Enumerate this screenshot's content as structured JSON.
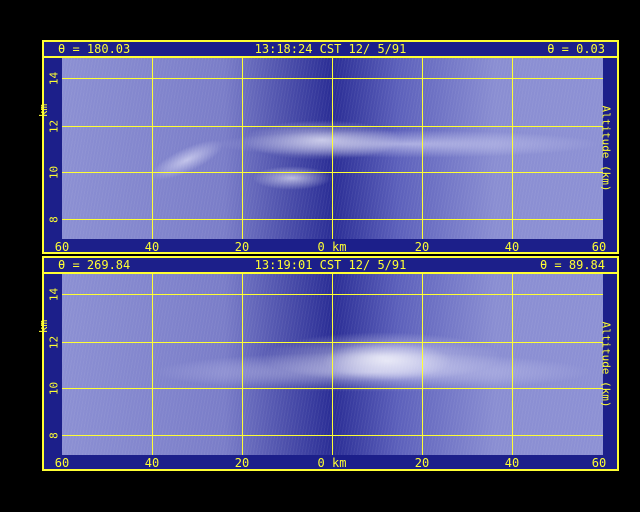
{
  "top_panel": {
    "theta_left": "θ = 180.03",
    "timestamp": "13:18:24 CST 12/ 5/91",
    "theta_right": "θ = 0.03",
    "y_label_left": "km",
    "y_label_right": "Altitude (km)",
    "y_ticks": [
      "8",
      "10",
      "12",
      "14"
    ],
    "x_ticks": [
      "60",
      "40",
      "20",
      "0 km",
      "20",
      "40",
      "60"
    ]
  },
  "bottom_panel": {
    "theta_left": "θ = 269.84",
    "timestamp": "13:19:01 CST 12/ 5/91",
    "theta_right": "θ = 89.84",
    "y_label_left": "km",
    "y_label_right": "Altitude (km)",
    "y_ticks": [
      "8",
      "10",
      "12",
      "14"
    ],
    "x_ticks": [
      "60",
      "40",
      "20",
      "0 km",
      "20",
      "40",
      "60"
    ]
  },
  "colors": {
    "frame": "#ffff33",
    "panel_bg": "#1c1f8a",
    "background": "#000000"
  }
}
